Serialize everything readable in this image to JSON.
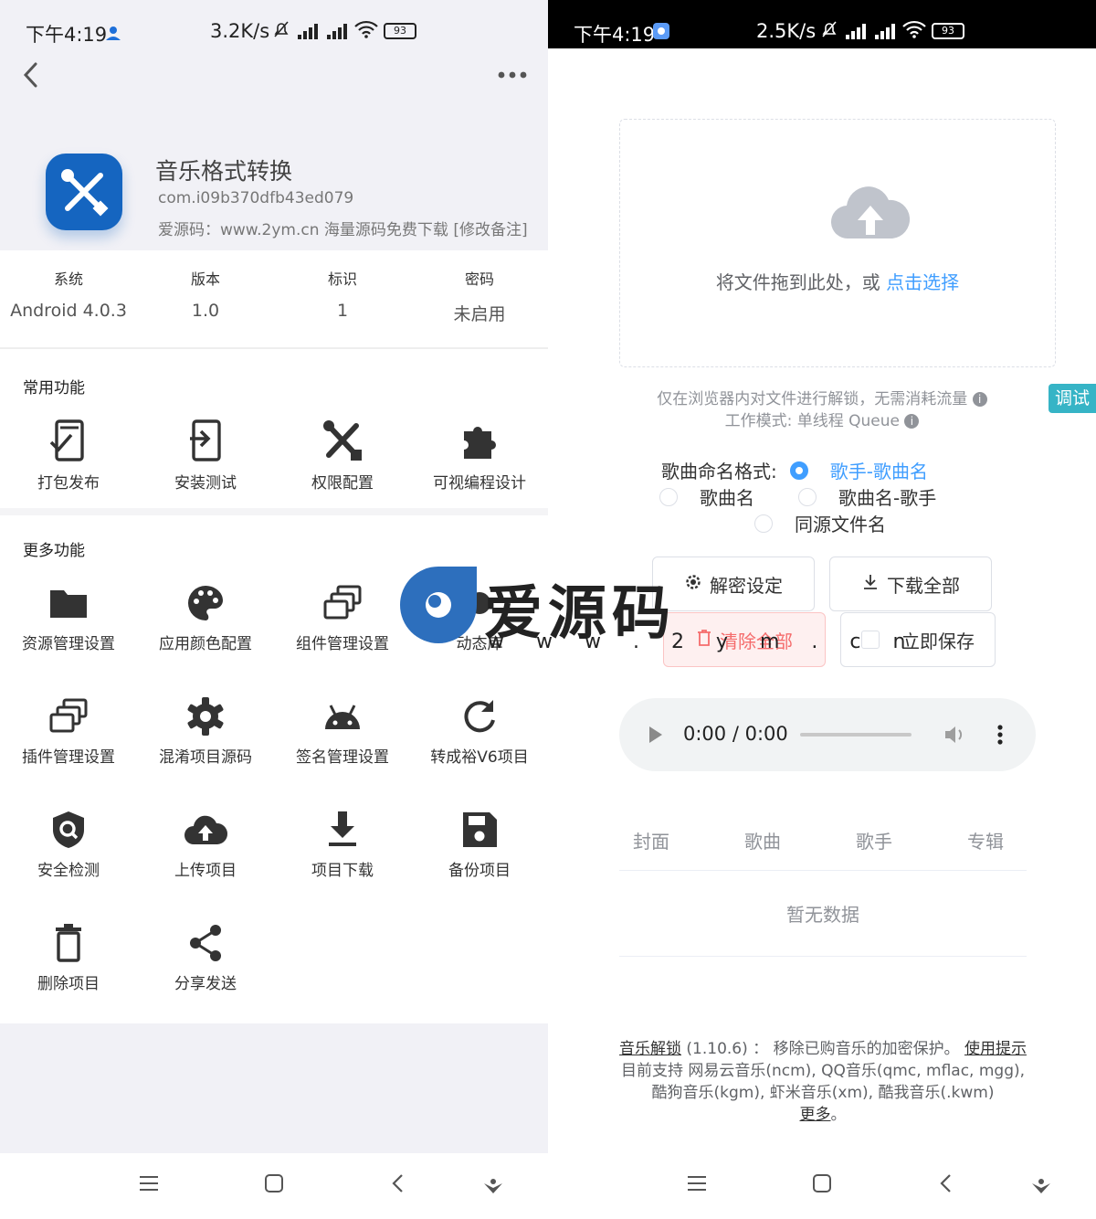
{
  "left": {
    "status": {
      "time": "下午4:19",
      "speed": "3.2K/s",
      "battery": "93"
    },
    "app": {
      "name": "音乐格式转换",
      "package": "com.i09b370dfb43ed079",
      "note": "爱源码：www.2ym.cn 海量源码免费下载 [修改备注]"
    },
    "info": [
      {
        "label": "系统",
        "value": "Android 4.0.3"
      },
      {
        "label": "版本",
        "value": "1.0"
      },
      {
        "label": "标识",
        "value": "1"
      },
      {
        "label": "密码",
        "value": "未启用"
      }
    ],
    "common_title": "常用功能",
    "common": [
      {
        "label": "打包发布",
        "icon": "package-publish-icon"
      },
      {
        "label": "安装测试",
        "icon": "install-test-icon"
      },
      {
        "label": "权限配置",
        "icon": "tools-icon"
      },
      {
        "label": "可视编程设计",
        "icon": "puzzle-icon"
      }
    ],
    "more_title": "更多功能",
    "more": [
      {
        "label": "资源管理设置",
        "icon": "folder-icon"
      },
      {
        "label": "应用颜色配置",
        "icon": "palette-icon"
      },
      {
        "label": "组件管理设置",
        "icon": "stack-icon"
      },
      {
        "label": "动态库",
        "icon": "dynamic-lib-icon"
      },
      {
        "label": "插件管理设置",
        "icon": "stack-icon"
      },
      {
        "label": "混淆项目源码",
        "icon": "gear-icon"
      },
      {
        "label": "签名管理设置",
        "icon": "android-icon"
      },
      {
        "label": "转成裕V6项目",
        "icon": "refresh-icon"
      },
      {
        "label": "安全检测",
        "icon": "shield-icon"
      },
      {
        "label": "上传项目",
        "icon": "cloud-upload-icon"
      },
      {
        "label": "项目下载",
        "icon": "download-icon"
      },
      {
        "label": "备份项目",
        "icon": "save-icon"
      },
      {
        "label": "删除项目",
        "icon": "trash-icon"
      },
      {
        "label": "分享发送",
        "icon": "share-icon"
      }
    ]
  },
  "right": {
    "status": {
      "time": "下午4:19",
      "speed": "2.5K/s",
      "battery": "93"
    },
    "dropzone": {
      "text": "将文件拖到此处，或 ",
      "link": "点击选择"
    },
    "hint1": "仅在浏览器内对文件进行解锁，无需消耗流量",
    "hint2": "工作模式: 单线程 Queue",
    "debug_tab": "调试",
    "naming_label": "歌曲命名格式:",
    "naming_options": [
      {
        "label": "歌手-歌曲名",
        "selected": true
      },
      {
        "label": "歌曲名",
        "selected": false
      },
      {
        "label": "歌曲名-歌手",
        "selected": false
      },
      {
        "label": "同源文件名",
        "selected": false
      }
    ],
    "buttons": {
      "decrypt": "解密设定",
      "download_all": "下载全部",
      "clear_all": "清除全部",
      "save_now": "立即保存"
    },
    "player": {
      "time": "0:00 / 0:00"
    },
    "table": {
      "headers": [
        "封面",
        "歌曲",
        "歌手",
        "专辑"
      ],
      "empty": "暂无数据"
    },
    "footer": {
      "link1": "音乐解锁",
      "version_text": " (1.10.6) ： 移除已购音乐的加密保护。 ",
      "link2": "使用提示",
      "support": "目前支持 网易云音乐(ncm), QQ音乐(qmc, mflac, mgg), 酷狗音乐(kgm), 虾米音乐(xm), 酷我音乐(.kwm) ",
      "link3": "更多",
      "end": "。"
    }
  },
  "watermark": {
    "title": "爱源码",
    "url": "w w w . 2 y m . c n"
  },
  "colors": {
    "accent": "#409eff",
    "app_icon": "#1565c0",
    "danger": "#f56c6c",
    "debug": "#36b4c6"
  }
}
